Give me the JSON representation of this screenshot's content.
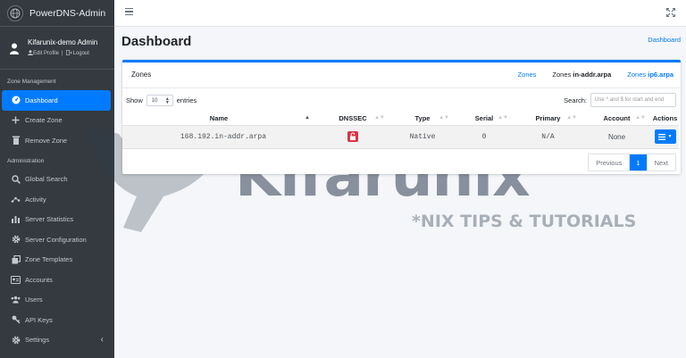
{
  "app": {
    "title": "PowerDNS-Admin"
  },
  "user": {
    "name": "Kifarunix-demo Admin",
    "edit_profile": "Edit Profile",
    "logout": "Logout"
  },
  "sidebar": {
    "sections": [
      {
        "header": "Zone Management",
        "items": [
          {
            "label": "Dashboard",
            "icon": "dashboard-icon",
            "active": true
          },
          {
            "label": "Create Zone",
            "icon": "plus-icon"
          },
          {
            "label": "Remove Zone",
            "icon": "trash-icon"
          }
        ]
      },
      {
        "header": "Administration",
        "items": [
          {
            "label": "Global Search",
            "icon": "search-icon"
          },
          {
            "label": "Activity",
            "icon": "activity-icon"
          },
          {
            "label": "Server Statistics",
            "icon": "bar-chart-icon"
          },
          {
            "label": "Server Configuration",
            "icon": "gear-icon"
          },
          {
            "label": "Zone Templates",
            "icon": "templates-icon"
          },
          {
            "label": "Accounts",
            "icon": "accounts-icon"
          },
          {
            "label": "Users",
            "icon": "users-icon"
          },
          {
            "label": "API Keys",
            "icon": "key-icon"
          },
          {
            "label": "Settings",
            "icon": "gear-icon"
          }
        ]
      }
    ]
  },
  "page": {
    "title": "Dashboard",
    "breadcrumb": "Dashboard"
  },
  "zones_card": {
    "title": "Zones",
    "tabs": [
      {
        "label": "Zones",
        "prefix": "",
        "bold": ""
      },
      {
        "label": "",
        "prefix": "Zones ",
        "bold": "in-addr.arpa"
      },
      {
        "label": "",
        "prefix": "Zones ",
        "bold": "ip6.arpa"
      }
    ],
    "show_label": "Show",
    "entries_value": "10",
    "entries_label": "entries",
    "search_label": "Search:",
    "search_placeholder": "Use ^ and $ for start and end",
    "columns": [
      "Name",
      "DNSSEC",
      "Type",
      "Serial",
      "Primary",
      "Account",
      "Actions"
    ],
    "rows": [
      {
        "name": "168.192.in-addr.arpa",
        "type": "Native",
        "serial": "0",
        "primary": "N/A",
        "account": "None"
      }
    ],
    "pagination": {
      "previous": "Previous",
      "current": "1",
      "next": "Next"
    }
  },
  "watermark": {
    "text": "Kifarunix",
    "subtitle": "*NIX TIPS & TUTORIALS"
  },
  "colors": {
    "accent": "#007bff",
    "sidebar": "#343a40",
    "danger": "#dc3545"
  }
}
